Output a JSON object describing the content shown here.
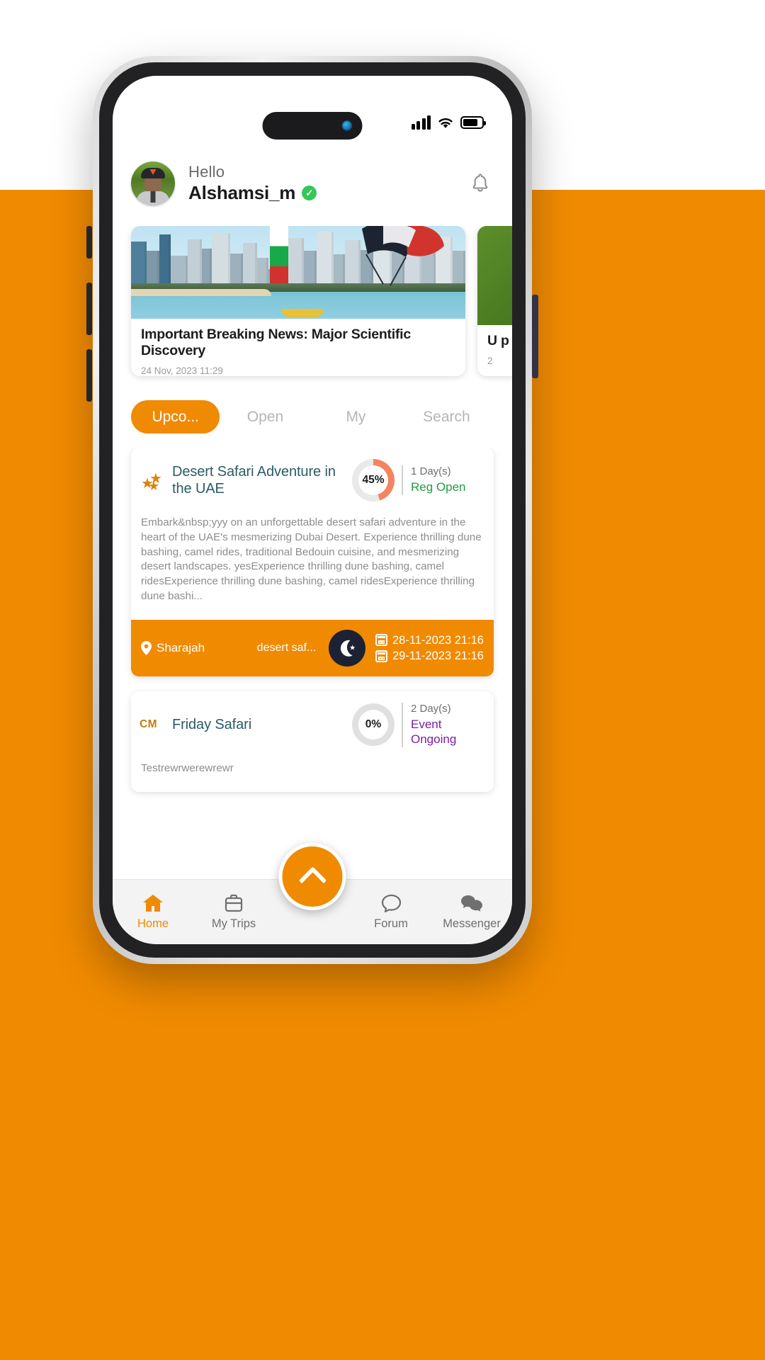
{
  "status_bar": {
    "signal_icon": "signal-bars-icon",
    "wifi_icon": "wifi-icon",
    "battery_icon": "battery-icon"
  },
  "header": {
    "greeting": "Hello",
    "username": "Alshamsi_m",
    "verified_badge": "✓",
    "avatar_name": "user-avatar",
    "bell_icon": "bell-icon"
  },
  "news": {
    "cards": [
      {
        "title": "Important Breaking News: Major Scientific Discovery",
        "date": "24 Nov, 2023 11:29",
        "image": "city-skyline-uae-flag-parasail"
      },
      {
        "title": "U p",
        "date": "2",
        "image": "green-foliage"
      }
    ]
  },
  "tabs": {
    "items": [
      {
        "label": "Upco...",
        "active": true
      },
      {
        "label": "Open",
        "active": false
      },
      {
        "label": "My",
        "active": false
      },
      {
        "label": "Search",
        "active": false
      }
    ]
  },
  "events": [
    {
      "badge_type": "stars",
      "badge_value": "★★★",
      "title": "Desert Safari Adventure in the UAE",
      "progress": "45%",
      "progress_value": 45,
      "progress_color": "#F4845F",
      "days": "1 Day(s)",
      "state": "Reg Open",
      "state_color": "#1f9d3f",
      "description": "Embark&nbsp;yyy on an unforgettable desert safari adventure in the heart of the UAE's mesmerizing Dubai Desert. Experience thrilling dune bashing, camel rides, traditional Bedouin cuisine, and mesmerizing desert landscapes. yesExperience thrilling dune bashing, camel ridesExperience thrilling dune bashing, camel ridesExperience thrilling dune bashi...",
      "location": "Sharajah",
      "tag": "desert saf...",
      "icon": "crescent-moon-icon",
      "date_start": "28-11-2023 21:16",
      "date_end": "29-11-2023 21:16"
    },
    {
      "badge_type": "code",
      "badge_value": "CM",
      "title": "Friday Safari",
      "progress": "0%",
      "progress_value": 0,
      "progress_color": "#e0e0e0",
      "days": "2 Day(s)",
      "state": "Event Ongoing",
      "state_color": "#7a1fa2",
      "description": "Testrewrwerewrewr"
    }
  ],
  "bottom_nav": {
    "items": [
      {
        "label": "Home",
        "icon": "home-icon",
        "active": true
      },
      {
        "label": "My Trips",
        "icon": "briefcase-icon",
        "active": false
      },
      {
        "label": "Forum",
        "icon": "chat-bubble-icon",
        "active": false
      },
      {
        "label": "Messenger",
        "icon": "messages-icon",
        "active": false
      }
    ],
    "fab_icon": "chevron-up-icon"
  },
  "theme": {
    "accent": "#F08A00",
    "title_color": "#2a5b66",
    "page_bg": "#F08A00"
  }
}
